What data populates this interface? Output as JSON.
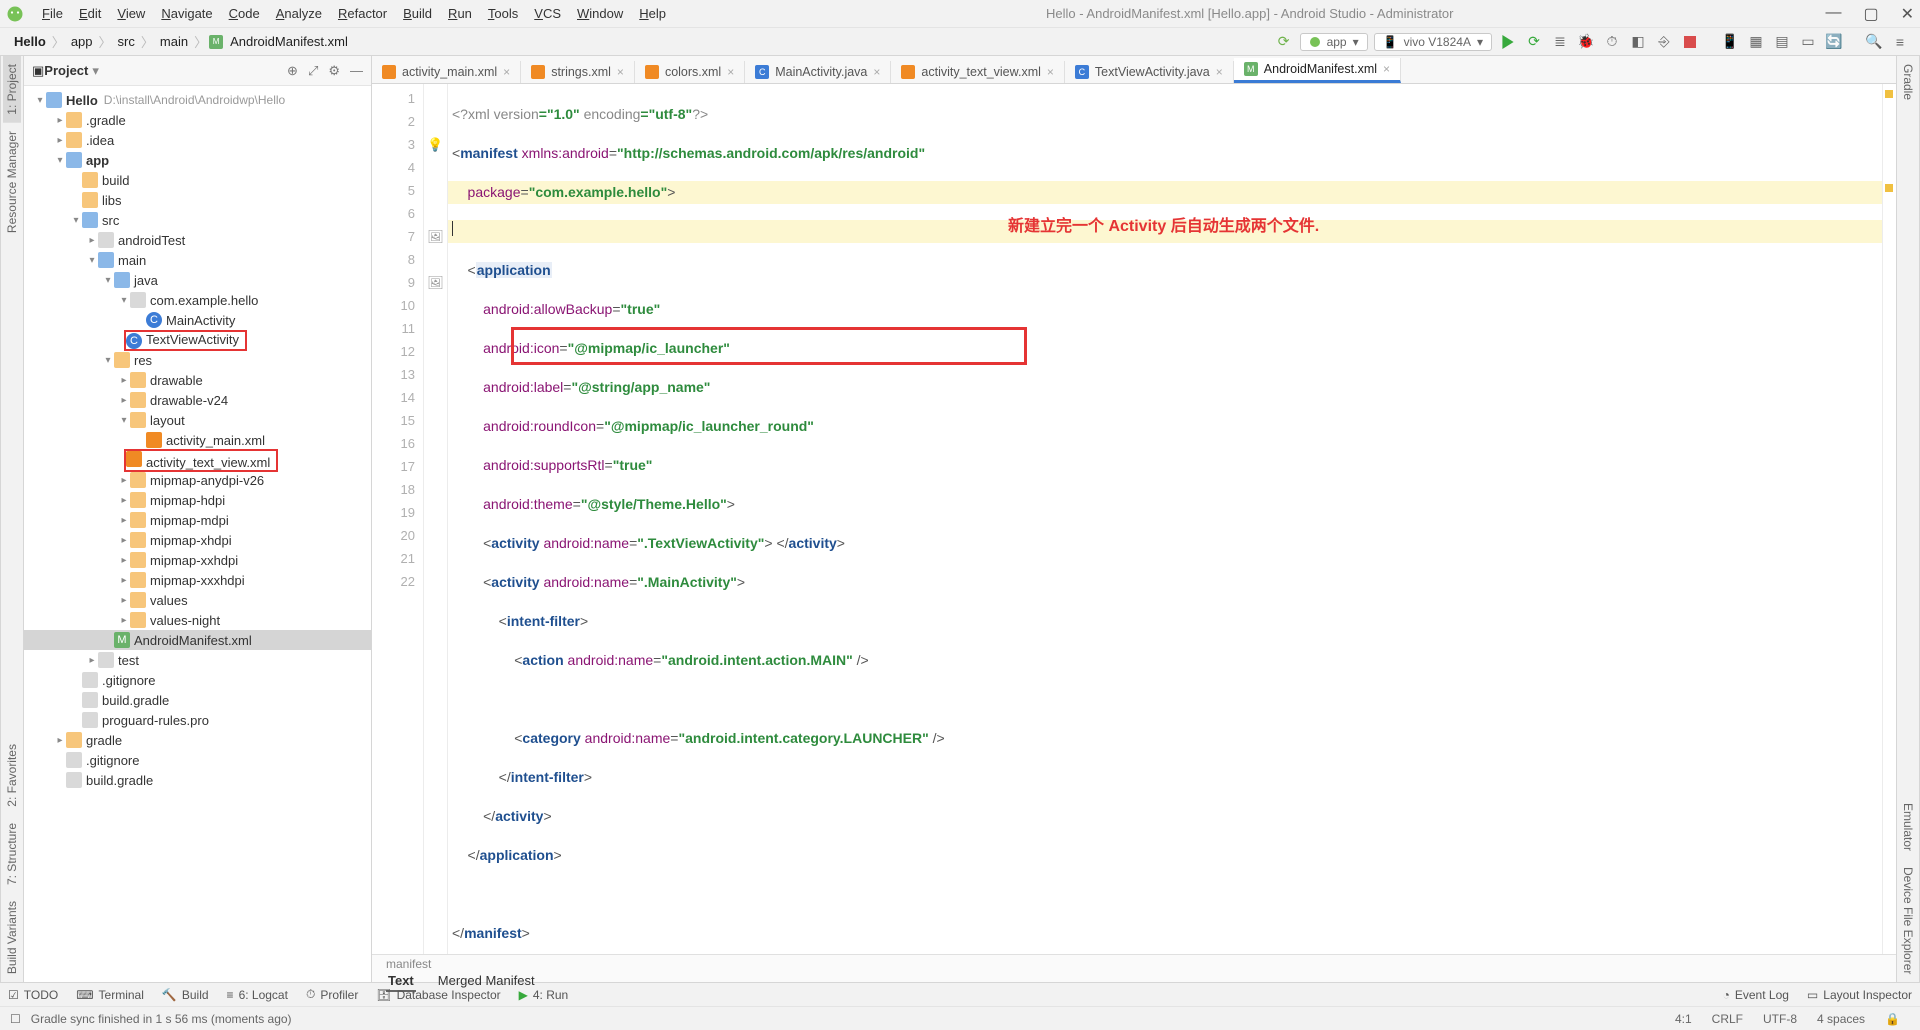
{
  "window": {
    "title": "Hello - AndroidManifest.xml [Hello.app] - Android Studio - Administrator"
  },
  "menu": {
    "items": [
      "File",
      "Edit",
      "View",
      "Navigate",
      "Code",
      "Analyze",
      "Refactor",
      "Build",
      "Run",
      "Tools",
      "VCS",
      "Window",
      "Help"
    ]
  },
  "breadcrumb": [
    "Hello",
    "app",
    "src",
    "main",
    "AndroidManifest.xml"
  ],
  "toolbar": {
    "run_config": "app",
    "device": "vivo V1824A",
    "device_arrow": "▾"
  },
  "left_tabs": [
    "1: Project",
    "Resource Manager"
  ],
  "right_tabs": [
    "Gradle",
    "Emulator",
    "Device File Explorer"
  ],
  "left_side_bottom": [
    "2: Favorites",
    "7: Structure",
    "Build Variants"
  ],
  "project_panel": {
    "title": "Project",
    "root": {
      "label": "Hello",
      "path": "D:\\install\\Android\\Androidwp\\Hello"
    },
    "nodes": [
      {
        "d": 1,
        "ic": "folder",
        "chev": "▸",
        "label": ".gradle"
      },
      {
        "d": 1,
        "ic": "folder",
        "chev": "▸",
        "label": ".idea"
      },
      {
        "d": 1,
        "ic": "folder-blue",
        "chev": "▾",
        "label": "app",
        "bold": true
      },
      {
        "d": 2,
        "ic": "folder",
        "chev": "",
        "label": "build"
      },
      {
        "d": 2,
        "ic": "folder",
        "chev": "",
        "label": "libs"
      },
      {
        "d": 2,
        "ic": "folder-blue",
        "chev": "▾",
        "label": "src"
      },
      {
        "d": 3,
        "ic": "folder-grey",
        "chev": "▸",
        "label": "androidTest"
      },
      {
        "d": 3,
        "ic": "folder-blue",
        "chev": "▾",
        "label": "main"
      },
      {
        "d": 4,
        "ic": "folder-blue",
        "chev": "▾",
        "label": "java"
      },
      {
        "d": 5,
        "ic": "folder-grey",
        "chev": "▾",
        "label": "com.example.hello"
      },
      {
        "d": 6,
        "ic": "class",
        "chev": "",
        "label": "MainActivity",
        "glyph": "C"
      },
      {
        "d": 6,
        "ic": "class",
        "chev": "",
        "label": "TextViewActivity",
        "glyph": "C",
        "redbox": true
      },
      {
        "d": 4,
        "ic": "folder",
        "chev": "▾",
        "label": "res"
      },
      {
        "d": 5,
        "ic": "folder",
        "chev": "▸",
        "label": "drawable"
      },
      {
        "d": 5,
        "ic": "folder",
        "chev": "▸",
        "label": "drawable-v24"
      },
      {
        "d": 5,
        "ic": "folder",
        "chev": "▾",
        "label": "layout"
      },
      {
        "d": 6,
        "ic": "xml",
        "chev": "",
        "label": "activity_main.xml"
      },
      {
        "d": 6,
        "ic": "xml",
        "chev": "",
        "label": "activity_text_view.xml",
        "redbox": true
      },
      {
        "d": 5,
        "ic": "folder",
        "chev": "▸",
        "label": "mipmap-anydpi-v26"
      },
      {
        "d": 5,
        "ic": "folder",
        "chev": "▸",
        "label": "mipmap-hdpi"
      },
      {
        "d": 5,
        "ic": "folder",
        "chev": "▸",
        "label": "mipmap-mdpi"
      },
      {
        "d": 5,
        "ic": "folder",
        "chev": "▸",
        "label": "mipmap-xhdpi"
      },
      {
        "d": 5,
        "ic": "folder",
        "chev": "▸",
        "label": "mipmap-xxhdpi"
      },
      {
        "d": 5,
        "ic": "folder",
        "chev": "▸",
        "label": "mipmap-xxxhdpi"
      },
      {
        "d": 5,
        "ic": "folder",
        "chev": "▸",
        "label": "values"
      },
      {
        "d": 5,
        "ic": "folder",
        "chev": "▸",
        "label": "values-night"
      },
      {
        "d": 4,
        "ic": "manifest",
        "chev": "",
        "label": "AndroidManifest.xml",
        "selected": true,
        "glyph": "M"
      },
      {
        "d": 3,
        "ic": "folder-grey",
        "chev": "▸",
        "label": "test"
      },
      {
        "d": 2,
        "ic": "file",
        "chev": "",
        "label": ".gitignore"
      },
      {
        "d": 2,
        "ic": "file",
        "chev": "",
        "label": "build.gradle"
      },
      {
        "d": 2,
        "ic": "file",
        "chev": "",
        "label": "proguard-rules.pro"
      },
      {
        "d": 1,
        "ic": "folder",
        "chev": "▸",
        "label": "gradle"
      },
      {
        "d": 1,
        "ic": "file",
        "chev": "",
        "label": ".gitignore"
      },
      {
        "d": 1,
        "ic": "file",
        "chev": "",
        "label": "build.gradle"
      }
    ]
  },
  "editor_tabs": [
    {
      "label": "activity_main.xml",
      "ic": "xml"
    },
    {
      "label": "strings.xml",
      "ic": "xml"
    },
    {
      "label": "colors.xml",
      "ic": "xml"
    },
    {
      "label": "MainActivity.java",
      "ic": "class"
    },
    {
      "label": "activity_text_view.xml",
      "ic": "xml"
    },
    {
      "label": "TextViewActivity.java",
      "ic": "class"
    },
    {
      "label": "AndroidManifest.xml",
      "ic": "manifest",
      "active": true
    }
  ],
  "line_numbers": [
    "1",
    "2",
    "3",
    "4",
    "5",
    "6",
    "7",
    "8",
    "9",
    "10",
    "11",
    "12",
    "13",
    "14",
    "15",
    "16",
    "17",
    "18",
    "19",
    "20",
    "21",
    "22"
  ],
  "code": {
    "l1_a": "<?",
    "l1_b": "xml version",
    "l1_c": "=\"1.0\"",
    "l1_d": " encoding",
    "l1_e": "=\"utf-8\"",
    "l1_f": "?>",
    "l2_a": "<",
    "l2_b": "manifest ",
    "l2_c": "xmlns:",
    "l2_d": "android",
    "l2_e": "=",
    "l2_f": "\"http://schemas.android.com/apk/res/android\"",
    "l3_a": "    package",
    "l3_b": "=",
    "l3_c": "\"com.example.hello\"",
    "l3_d": ">",
    "l5_a": "    <",
    "l5_b": "application",
    "l6_a": "        android",
    "l6_b": ":allowBackup",
    "l6_c": "=",
    "l6_d": "\"true\"",
    "l7_a": "        android",
    "l7_b": ":icon",
    "l7_c": "=",
    "l7_d": "\"@mipmap/ic_launcher\"",
    "l8_a": "        android",
    "l8_b": ":label",
    "l8_c": "=",
    "l8_d": "\"@string/app_name\"",
    "l9_a": "        android",
    "l9_b": ":roundIcon",
    "l9_c": "=",
    "l9_d": "\"@mipmap/ic_launcher_round\"",
    "l10_a": "        android",
    "l10_b": ":supportsRtl",
    "l10_c": "=",
    "l10_d": "\"true\"",
    "l11_a": "        android",
    "l11_b": ":theme",
    "l11_c": "=",
    "l11_d": "\"@style/Theme.Hello\"",
    "l11_e": ">",
    "l12_a": "        <",
    "l12_b": "activity ",
    "l12_c": "android",
    "l12_d": ":name",
    "l12_e": "=",
    "l12_f": "\".TextViewActivity\"",
    "l12_g": "> </",
    "l12_h": "activity",
    "l12_i": ">",
    "l13_a": "        <",
    "l13_b": "activity ",
    "l13_c": "android",
    "l13_d": ":name",
    "l13_e": "=",
    "l13_f": "\".MainActivity\"",
    "l13_g": ">",
    "l14_a": "            <",
    "l14_b": "intent-filter",
    "l14_c": ">",
    "l15_a": "                <",
    "l15_b": "action ",
    "l15_c": "android",
    "l15_d": ":name",
    "l15_e": "=",
    "l15_f": "\"android.intent.action.MAIN\"",
    "l15_g": " />",
    "l17_a": "                <",
    "l17_b": "category ",
    "l17_c": "android",
    "l17_d": ":name",
    "l17_e": "=",
    "l17_f": "\"android.intent.category.LAUNCHER\"",
    "l17_g": " />",
    "l18_a": "            </",
    "l18_b": "intent-filter",
    "l18_c": ">",
    "l19_a": "        </",
    "l19_b": "activity",
    "l19_c": ">",
    "l20_a": "    </",
    "l20_b": "application",
    "l20_c": ">",
    "l22_a": "</",
    "l22_b": "manifest",
    "l22_c": ">"
  },
  "annotation_text": "新建立完一个 Activity 后自动生成两个文件.",
  "editor_footer": {
    "path_hint": "manifest",
    "tabs": [
      "Text",
      "Merged Manifest"
    ]
  },
  "bottombar": {
    "items_left": [
      "TODO",
      "Terminal",
      "Build",
      "6: Logcat",
      "Profiler",
      "Database Inspector",
      "4: Run"
    ],
    "items_right": [
      "Event Log",
      "Layout Inspector"
    ]
  },
  "status": {
    "msg": "Gradle sync finished in 1 s 56 ms (moments ago)",
    "pos": "4:1",
    "eol": "CRLF",
    "enc": "UTF-8",
    "indent": "4 spaces"
  }
}
